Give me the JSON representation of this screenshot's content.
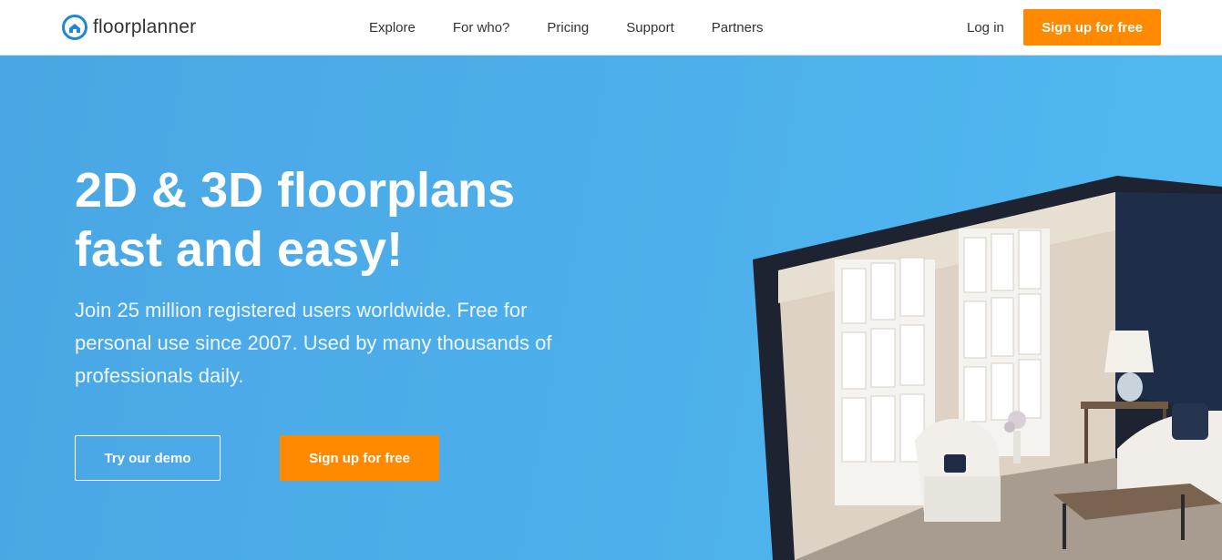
{
  "header": {
    "logo_text": "floorplanner",
    "nav": [
      {
        "label": "Explore"
      },
      {
        "label": "For who?"
      },
      {
        "label": "Pricing"
      },
      {
        "label": "Support"
      },
      {
        "label": "Partners"
      }
    ],
    "login_label": "Log in",
    "signup_label": "Sign up for free"
  },
  "hero": {
    "headline_line1": "2D & 3D floorplans",
    "headline_line2": "fast and easy!",
    "subtitle": "Join 25 million registered users worldwide. Free for personal use since 2007. Used by many thousands of professionals daily.",
    "demo_button": "Try our demo",
    "signup_button": "Sign up for free"
  },
  "colors": {
    "accent_orange": "#ff8a00",
    "hero_blue": "#4aa8e6",
    "logo_blue": "#1e88d3"
  }
}
